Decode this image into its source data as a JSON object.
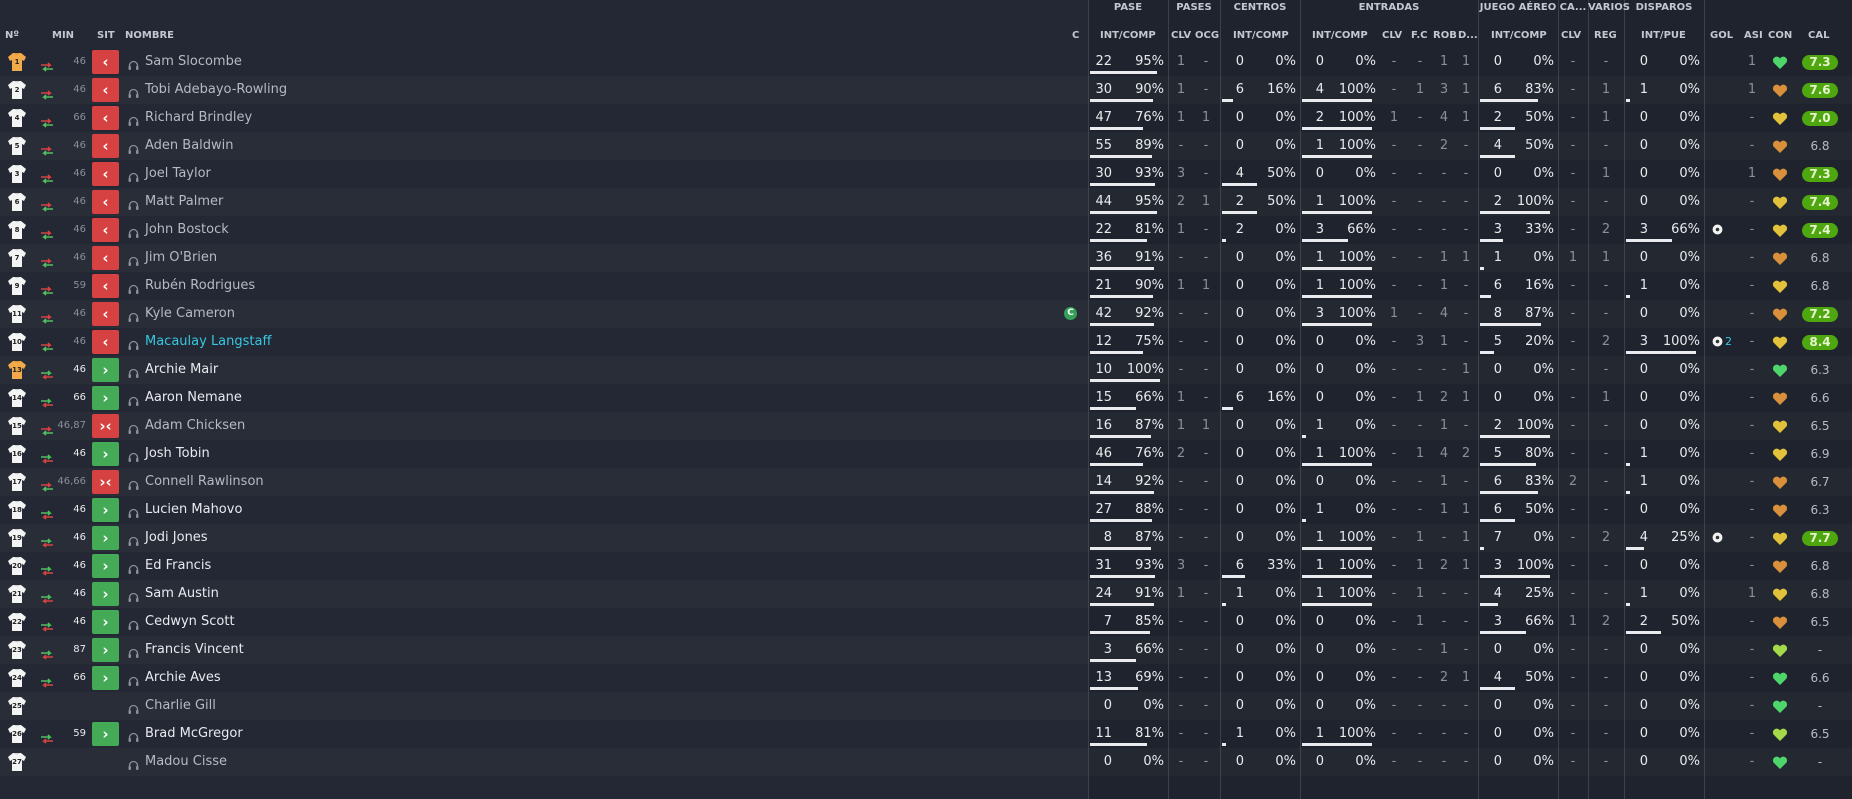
{
  "headers": {
    "groups": {
      "pase": "PASE",
      "pases": "PASES",
      "centros": "CENTROS",
      "entradas": "ENTRADAS",
      "juego_aereo": "JUEGO AÉREO",
      "ca": "CA...",
      "varios": "VARIOS",
      "disparos": "DISPAROS"
    },
    "cols": {
      "num": "Nº",
      "min": "MIN",
      "sit": "SIT",
      "nombre": "NOMBRE",
      "c": "C",
      "pase_intcomp": "INT/COMP",
      "pases_clv": "CLV",
      "pases_ocg": "OCG",
      "centros_intcomp": "INT/COMP",
      "entradas_intcomp": "INT/COMP",
      "entradas_clv": "CLV",
      "entradas_fc": "F.C",
      "entradas_rob": "ROB",
      "entradas_d": "D...",
      "aereo_intcomp": "INT/COMP",
      "ca_clv": "CLV",
      "varios_reg": "REG",
      "disparos_intpue": "INT/PUE",
      "gol": "GOL",
      "asi": "ASI",
      "con": "CON",
      "cal": "CAL"
    }
  },
  "colors": {
    "background": "#232834",
    "sub_out": "#d64242",
    "sub_in": "#44aa55",
    "rating_good": "#4ea70e",
    "highlight_name": "#38c7e0",
    "captain_badge": "#34a058"
  },
  "players": [
    {
      "num": "1",
      "min": "46",
      "sit": "out",
      "name": "Sam Slocombe",
      "gk": true,
      "captain": false,
      "pase": [
        "22",
        "95%"
      ],
      "pclv": "1",
      "pocg": "-",
      "cen": [
        "0",
        "0%"
      ],
      "ent": [
        "0",
        "0%"
      ],
      "eclv": "-",
      "efc": "-",
      "erob": "1",
      "ed": "1",
      "aer": [
        "0",
        "0%"
      ],
      "caclv": "-",
      "reg": "-",
      "dis": [
        "0",
        "0%"
      ],
      "gol": "",
      "asi": "1",
      "con": "green",
      "cal": "7.3",
      "cal_plain": false
    },
    {
      "num": "2",
      "min": "46",
      "sit": "out",
      "name": "Tobi Adebayo-Rowling",
      "gk": false,
      "captain": false,
      "pase": [
        "30",
        "90%"
      ],
      "pclv": "1",
      "pocg": "-",
      "cen": [
        "6",
        "16%"
      ],
      "ent": [
        "4",
        "100%"
      ],
      "eclv": "-",
      "efc": "1",
      "erob": "3",
      "ed": "1",
      "aer": [
        "6",
        "83%"
      ],
      "caclv": "-",
      "reg": "1",
      "dis": [
        "1",
        "0%"
      ],
      "gol": "",
      "asi": "1",
      "con": "orange",
      "cal": "7.6",
      "cal_plain": false
    },
    {
      "num": "4",
      "min": "66",
      "sit": "out",
      "name": "Richard Brindley",
      "gk": false,
      "captain": false,
      "pase": [
        "47",
        "76%"
      ],
      "pclv": "1",
      "pocg": "1",
      "cen": [
        "0",
        "0%"
      ],
      "ent": [
        "2",
        "100%"
      ],
      "eclv": "1",
      "efc": "-",
      "erob": "4",
      "ed": "1",
      "aer": [
        "2",
        "50%"
      ],
      "caclv": "-",
      "reg": "1",
      "dis": [
        "0",
        "0%"
      ],
      "gol": "",
      "asi": "-",
      "con": "yellow",
      "cal": "7.0",
      "cal_plain": false
    },
    {
      "num": "5",
      "min": "46",
      "sit": "out",
      "name": "Aden Baldwin",
      "gk": false,
      "captain": false,
      "pase": [
        "55",
        "89%"
      ],
      "pclv": "-",
      "pocg": "-",
      "cen": [
        "0",
        "0%"
      ],
      "ent": [
        "1",
        "100%"
      ],
      "eclv": "-",
      "efc": "-",
      "erob": "2",
      "ed": "-",
      "aer": [
        "4",
        "50%"
      ],
      "caclv": "-",
      "reg": "-",
      "dis": [
        "0",
        "0%"
      ],
      "gol": "",
      "asi": "-",
      "con": "orange",
      "cal": "6.8",
      "cal_plain": true
    },
    {
      "num": "3",
      "min": "46",
      "sit": "out",
      "name": "Joel Taylor",
      "gk": false,
      "captain": false,
      "pase": [
        "30",
        "93%"
      ],
      "pclv": "3",
      "pocg": "-",
      "cen": [
        "4",
        "50%"
      ],
      "ent": [
        "0",
        "0%"
      ],
      "eclv": "-",
      "efc": "-",
      "erob": "-",
      "ed": "-",
      "aer": [
        "0",
        "0%"
      ],
      "caclv": "-",
      "reg": "1",
      "dis": [
        "0",
        "0%"
      ],
      "gol": "",
      "asi": "1",
      "con": "orange",
      "cal": "7.3",
      "cal_plain": false
    },
    {
      "num": "6",
      "min": "46",
      "sit": "out",
      "name": "Matt Palmer",
      "gk": false,
      "captain": false,
      "pase": [
        "44",
        "95%"
      ],
      "pclv": "2",
      "pocg": "1",
      "cen": [
        "2",
        "50%"
      ],
      "ent": [
        "1",
        "100%"
      ],
      "eclv": "-",
      "efc": "-",
      "erob": "-",
      "ed": "-",
      "aer": [
        "2",
        "100%"
      ],
      "caclv": "-",
      "reg": "-",
      "dis": [
        "0",
        "0%"
      ],
      "gol": "",
      "asi": "-",
      "con": "yellow",
      "cal": "7.4",
      "cal_plain": false
    },
    {
      "num": "8",
      "min": "46",
      "sit": "out",
      "name": "John Bostock",
      "gk": false,
      "captain": false,
      "pase": [
        "22",
        "81%"
      ],
      "pclv": "1",
      "pocg": "-",
      "cen": [
        "2",
        "0%"
      ],
      "ent": [
        "3",
        "66%"
      ],
      "eclv": "-",
      "efc": "-",
      "erob": "-",
      "ed": "-",
      "aer": [
        "3",
        "33%"
      ],
      "caclv": "-",
      "reg": "2",
      "dis": [
        "3",
        "66%"
      ],
      "gol": "ball",
      "asi": "-",
      "con": "yellow",
      "cal": "7.4",
      "cal_plain": false
    },
    {
      "num": "7",
      "min": "46",
      "sit": "out",
      "name": "Jim O'Brien",
      "gk": false,
      "captain": false,
      "pase": [
        "36",
        "91%"
      ],
      "pclv": "-",
      "pocg": "-",
      "cen": [
        "0",
        "0%"
      ],
      "ent": [
        "1",
        "100%"
      ],
      "eclv": "-",
      "efc": "-",
      "erob": "1",
      "ed": "1",
      "aer": [
        "1",
        "0%"
      ],
      "caclv": "1",
      "reg": "1",
      "dis": [
        "0",
        "0%"
      ],
      "gol": "",
      "asi": "-",
      "con": "orange",
      "cal": "6.8",
      "cal_plain": true
    },
    {
      "num": "9",
      "min": "59",
      "sit": "out",
      "name": "Rubén Rodrigues",
      "gk": false,
      "captain": false,
      "pase": [
        "21",
        "90%"
      ],
      "pclv": "1",
      "pocg": "1",
      "cen": [
        "0",
        "0%"
      ],
      "ent": [
        "1",
        "100%"
      ],
      "eclv": "-",
      "efc": "-",
      "erob": "1",
      "ed": "-",
      "aer": [
        "6",
        "16%"
      ],
      "caclv": "-",
      "reg": "-",
      "dis": [
        "1",
        "0%"
      ],
      "gol": "",
      "asi": "-",
      "con": "yellow",
      "cal": "6.8",
      "cal_plain": true
    },
    {
      "num": "11",
      "min": "46",
      "sit": "out",
      "name": "Kyle Cameron",
      "gk": false,
      "captain": true,
      "pase": [
        "42",
        "92%"
      ],
      "pclv": "-",
      "pocg": "-",
      "cen": [
        "0",
        "0%"
      ],
      "ent": [
        "3",
        "100%"
      ],
      "eclv": "1",
      "efc": "-",
      "erob": "4",
      "ed": "-",
      "aer": [
        "8",
        "87%"
      ],
      "caclv": "-",
      "reg": "-",
      "dis": [
        "0",
        "0%"
      ],
      "gol": "",
      "asi": "-",
      "con": "orange",
      "cal": "7.2",
      "cal_plain": false
    },
    {
      "num": "10",
      "min": "46",
      "sit": "out",
      "name": "Macaulay Langstaff",
      "gk": false,
      "captain": false,
      "highlight": true,
      "pase": [
        "12",
        "75%"
      ],
      "pclv": "-",
      "pocg": "-",
      "cen": [
        "0",
        "0%"
      ],
      "ent": [
        "0",
        "0%"
      ],
      "eclv": "-",
      "efc": "3",
      "erob": "1",
      "ed": "-",
      "aer": [
        "5",
        "20%"
      ],
      "caclv": "-",
      "reg": "2",
      "dis": [
        "3",
        "100%"
      ],
      "gol": "2",
      "asi": "-",
      "con": "yellow",
      "cal": "8.4",
      "cal_plain": false
    },
    {
      "num": "13",
      "min": "46",
      "sit": "in",
      "name": "Archie Mair",
      "gk": true,
      "captain": false,
      "pase": [
        "10",
        "100%"
      ],
      "pclv": "-",
      "pocg": "-",
      "cen": [
        "0",
        "0%"
      ],
      "ent": [
        "0",
        "0%"
      ],
      "eclv": "-",
      "efc": "-",
      "erob": "-",
      "ed": "1",
      "aer": [
        "0",
        "0%"
      ],
      "caclv": "-",
      "reg": "-",
      "dis": [
        "0",
        "0%"
      ],
      "gol": "",
      "asi": "-",
      "con": "green",
      "cal": "6.3",
      "cal_plain": true
    },
    {
      "num": "14",
      "min": "66",
      "sit": "in",
      "name": "Aaron Nemane",
      "gk": false,
      "captain": false,
      "pase": [
        "15",
        "66%"
      ],
      "pclv": "1",
      "pocg": "-",
      "cen": [
        "6",
        "16%"
      ],
      "ent": [
        "0",
        "0%"
      ],
      "eclv": "-",
      "efc": "1",
      "erob": "2",
      "ed": "1",
      "aer": [
        "0",
        "0%"
      ],
      "caclv": "-",
      "reg": "1",
      "dis": [
        "0",
        "0%"
      ],
      "gol": "",
      "asi": "-",
      "con": "orange",
      "cal": "6.6",
      "cal_plain": true
    },
    {
      "num": "15",
      "min": "46,87",
      "sit": "inout",
      "name": "Adam Chicksen",
      "gk": false,
      "captain": false,
      "pase": [
        "16",
        "87%"
      ],
      "pclv": "1",
      "pocg": "1",
      "cen": [
        "0",
        "0%"
      ],
      "ent": [
        "1",
        "0%"
      ],
      "eclv": "-",
      "efc": "-",
      "erob": "1",
      "ed": "-",
      "aer": [
        "2",
        "100%"
      ],
      "caclv": "-",
      "reg": "-",
      "dis": [
        "0",
        "0%"
      ],
      "gol": "",
      "asi": "-",
      "con": "yellow",
      "cal": "6.5",
      "cal_plain": true
    },
    {
      "num": "16",
      "min": "46",
      "sit": "in",
      "name": "Josh Tobin",
      "gk": false,
      "captain": false,
      "pase": [
        "46",
        "76%"
      ],
      "pclv": "2",
      "pocg": "-",
      "cen": [
        "0",
        "0%"
      ],
      "ent": [
        "1",
        "100%"
      ],
      "eclv": "-",
      "efc": "1",
      "erob": "4",
      "ed": "2",
      "aer": [
        "5",
        "80%"
      ],
      "caclv": "-",
      "reg": "-",
      "dis": [
        "1",
        "0%"
      ],
      "gol": "",
      "asi": "-",
      "con": "yellow",
      "cal": "6.9",
      "cal_plain": true
    },
    {
      "num": "17",
      "min": "46,66",
      "sit": "inout",
      "name": "Connell Rawlinson",
      "gk": false,
      "captain": false,
      "pase": [
        "14",
        "92%"
      ],
      "pclv": "-",
      "pocg": "-",
      "cen": [
        "0",
        "0%"
      ],
      "ent": [
        "0",
        "0%"
      ],
      "eclv": "-",
      "efc": "-",
      "erob": "1",
      "ed": "-",
      "aer": [
        "6",
        "83%"
      ],
      "caclv": "2",
      "reg": "-",
      "dis": [
        "1",
        "0%"
      ],
      "gol": "",
      "asi": "-",
      "con": "orange",
      "cal": "6.7",
      "cal_plain": true
    },
    {
      "num": "18",
      "min": "46",
      "sit": "in",
      "name": "Lucien Mahovo",
      "gk": false,
      "captain": false,
      "pase": [
        "27",
        "88%"
      ],
      "pclv": "-",
      "pocg": "-",
      "cen": [
        "0",
        "0%"
      ],
      "ent": [
        "1",
        "0%"
      ],
      "eclv": "-",
      "efc": "-",
      "erob": "1",
      "ed": "1",
      "aer": [
        "6",
        "50%"
      ],
      "caclv": "-",
      "reg": "-",
      "dis": [
        "0",
        "0%"
      ],
      "gol": "",
      "asi": "-",
      "con": "orange",
      "cal": "6.3",
      "cal_plain": true
    },
    {
      "num": "19",
      "min": "46",
      "sit": "in",
      "name": "Jodi Jones",
      "gk": false,
      "captain": false,
      "pase": [
        "8",
        "87%"
      ],
      "pclv": "-",
      "pocg": "-",
      "cen": [
        "0",
        "0%"
      ],
      "ent": [
        "1",
        "100%"
      ],
      "eclv": "-",
      "efc": "1",
      "erob": "-",
      "ed": "1",
      "aer": [
        "7",
        "0%"
      ],
      "caclv": "-",
      "reg": "2",
      "dis": [
        "4",
        "25%"
      ],
      "gol": "ball",
      "asi": "-",
      "con": "yellow",
      "cal": "7.7",
      "cal_plain": false
    },
    {
      "num": "20",
      "min": "46",
      "sit": "in",
      "name": "Ed Francis",
      "gk": false,
      "captain": false,
      "pase": [
        "31",
        "93%"
      ],
      "pclv": "3",
      "pocg": "-",
      "cen": [
        "6",
        "33%"
      ],
      "ent": [
        "1",
        "100%"
      ],
      "eclv": "-",
      "efc": "1",
      "erob": "2",
      "ed": "1",
      "aer": [
        "3",
        "100%"
      ],
      "caclv": "-",
      "reg": "-",
      "dis": [
        "0",
        "0%"
      ],
      "gol": "",
      "asi": "-",
      "con": "orange",
      "cal": "6.8",
      "cal_plain": true
    },
    {
      "num": "21",
      "min": "46",
      "sit": "in",
      "name": "Sam Austin",
      "gk": false,
      "captain": false,
      "pase": [
        "24",
        "91%"
      ],
      "pclv": "1",
      "pocg": "-",
      "cen": [
        "1",
        "0%"
      ],
      "ent": [
        "1",
        "100%"
      ],
      "eclv": "-",
      "efc": "1",
      "erob": "-",
      "ed": "-",
      "aer": [
        "4",
        "25%"
      ],
      "caclv": "-",
      "reg": "-",
      "dis": [
        "1",
        "0%"
      ],
      "gol": "",
      "asi": "1",
      "con": "yellow",
      "cal": "6.8",
      "cal_plain": true
    },
    {
      "num": "22",
      "min": "46",
      "sit": "in",
      "name": "Cedwyn Scott",
      "gk": false,
      "captain": false,
      "pase": [
        "7",
        "85%"
      ],
      "pclv": "-",
      "pocg": "-",
      "cen": [
        "0",
        "0%"
      ],
      "ent": [
        "0",
        "0%"
      ],
      "eclv": "-",
      "efc": "1",
      "erob": "-",
      "ed": "-",
      "aer": [
        "3",
        "66%"
      ],
      "caclv": "1",
      "reg": "2",
      "dis": [
        "2",
        "50%"
      ],
      "gol": "",
      "asi": "-",
      "con": "orange",
      "cal": "6.5",
      "cal_plain": true
    },
    {
      "num": "23",
      "min": "87",
      "sit": "in",
      "name": "Francis Vincent",
      "gk": false,
      "captain": false,
      "pase": [
        "3",
        "66%"
      ],
      "pclv": "-",
      "pocg": "-",
      "cen": [
        "0",
        "0%"
      ],
      "ent": [
        "0",
        "0%"
      ],
      "eclv": "-",
      "efc": "-",
      "erob": "1",
      "ed": "-",
      "aer": [
        "0",
        "0%"
      ],
      "caclv": "-",
      "reg": "-",
      "dis": [
        "0",
        "0%"
      ],
      "gol": "",
      "asi": "-",
      "con": "lime",
      "cal": "-",
      "cal_plain": true
    },
    {
      "num": "24",
      "min": "66",
      "sit": "in",
      "name": "Archie Aves",
      "gk": false,
      "captain": false,
      "pase": [
        "13",
        "69%"
      ],
      "pclv": "-",
      "pocg": "-",
      "cen": [
        "0",
        "0%"
      ],
      "ent": [
        "0",
        "0%"
      ],
      "eclv": "-",
      "efc": "-",
      "erob": "2",
      "ed": "1",
      "aer": [
        "4",
        "50%"
      ],
      "caclv": "-",
      "reg": "-",
      "dis": [
        "0",
        "0%"
      ],
      "gol": "",
      "asi": "-",
      "con": "green",
      "cal": "6.6",
      "cal_plain": true
    },
    {
      "num": "25",
      "min": "",
      "sit": "none",
      "name": "Charlie Gill",
      "gk": false,
      "captain": false,
      "pase": [
        "0",
        "0%"
      ],
      "pclv": "-",
      "pocg": "-",
      "cen": [
        "0",
        "0%"
      ],
      "ent": [
        "0",
        "0%"
      ],
      "eclv": "-",
      "efc": "-",
      "erob": "-",
      "ed": "-",
      "aer": [
        "0",
        "0%"
      ],
      "caclv": "-",
      "reg": "-",
      "dis": [
        "0",
        "0%"
      ],
      "gol": "",
      "asi": "-",
      "con": "green",
      "cal": "-",
      "cal_plain": true
    },
    {
      "num": "26",
      "min": "59",
      "sit": "in",
      "name": "Brad McGregor",
      "gk": false,
      "captain": false,
      "pase": [
        "11",
        "81%"
      ],
      "pclv": "-",
      "pocg": "-",
      "cen": [
        "1",
        "0%"
      ],
      "ent": [
        "1",
        "100%"
      ],
      "eclv": "-",
      "efc": "-",
      "erob": "-",
      "ed": "-",
      "aer": [
        "0",
        "0%"
      ],
      "caclv": "-",
      "reg": "-",
      "dis": [
        "0",
        "0%"
      ],
      "gol": "",
      "asi": "-",
      "con": "lime",
      "cal": "6.5",
      "cal_plain": true
    },
    {
      "num": "27",
      "min": "",
      "sit": "none",
      "name": "Madou Cisse",
      "gk": false,
      "captain": false,
      "pase": [
        "0",
        "0%"
      ],
      "pclv": "-",
      "pocg": "-",
      "cen": [
        "0",
        "0%"
      ],
      "ent": [
        "0",
        "0%"
      ],
      "eclv": "-",
      "efc": "-",
      "erob": "-",
      "ed": "-",
      "aer": [
        "0",
        "0%"
      ],
      "caclv": "-",
      "reg": "-",
      "dis": [
        "0",
        "0%"
      ],
      "gol": "",
      "asi": "-",
      "con": "green",
      "cal": "-",
      "cal_plain": true
    }
  ]
}
